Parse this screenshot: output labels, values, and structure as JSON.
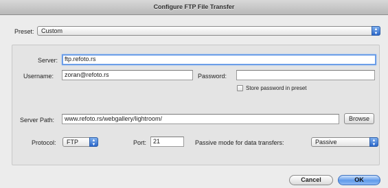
{
  "window": {
    "title": "Configure FTP File Transfer"
  },
  "preset": {
    "label": "Preset:",
    "value": "Custom"
  },
  "server": {
    "label": "Server:",
    "value": "ftp.refoto.rs"
  },
  "username": {
    "label": "Username:",
    "value": "zoran@refoto.rs"
  },
  "password": {
    "label": "Password:",
    "value": "",
    "store_label": "Store password in preset"
  },
  "server_path": {
    "label": "Server Path:",
    "value": "www.refoto.rs/webgallery/lightroom/",
    "browse_label": "Browse"
  },
  "protocol": {
    "label": "Protocol:",
    "value": "FTP"
  },
  "port": {
    "label": "Port:",
    "value": "21"
  },
  "passive": {
    "label": "Passive mode for data transfers:",
    "value": "Passive"
  },
  "actions": {
    "cancel_label": "Cancel",
    "ok_label": "OK"
  },
  "colors": {
    "accent": "#2a66c9",
    "focus_ring": "#6c9ee8"
  },
  "icons": {
    "stepper": "up-down-arrows-icon"
  }
}
